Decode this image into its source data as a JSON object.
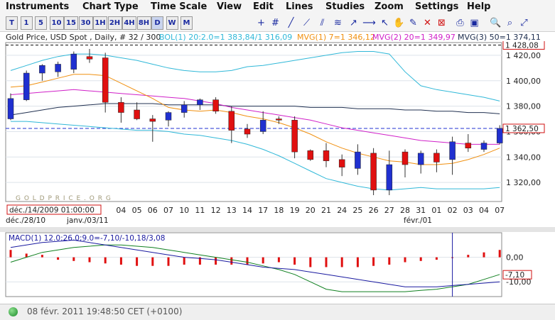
{
  "menu": [
    "Instruments",
    "Chart Type",
    "Time Scale",
    "View",
    "Edit",
    "Lines",
    "Studies",
    "Zoom",
    "Settings",
    "Help"
  ],
  "toolbar": {
    "period_buttons": [
      "T",
      "1",
      "5",
      "10",
      "15",
      "30",
      "1H",
      "2H",
      "4H",
      "8H",
      "D",
      "W",
      "M"
    ],
    "selected": "D"
  },
  "header": {
    "instrument": "Gold Price, USD Spot , Daily, # 32 / 300",
    "bol": "BOL(1) 20:2.0=1 383,84/1 316,09",
    "mvg1": "MVG(1) 7=1 346,12",
    "mvg2": "MVG(2) 20=1 349,97",
    "mvg3": "MVG(3) 50=1 374,11"
  },
  "price_chart": {
    "y_ticks": [
      "1 420,00",
      "1 400,00",
      "1 380,00",
      "1 360,00",
      "1 340,00",
      "1 320,00"
    ],
    "current_price": "1 362,50",
    "top_line_label": "1 428,08",
    "watermark": "G O L D P R I C E . O R G",
    "cursor_date": "déc./14/2009 01:00:00",
    "date_labels": [
      "04",
      "05",
      "06",
      "07",
      "10",
      "11",
      "12",
      "13",
      "14",
      "17",
      "18",
      "19",
      "20",
      "21",
      "24",
      "25",
      "26",
      "27",
      "28",
      "31",
      "01",
      "02",
      "03",
      "04",
      "07"
    ],
    "month_labels": [
      "déc./28/10",
      "janv./03/11",
      "févr./01"
    ]
  },
  "macd_chart": {
    "label": "MACD(1) 12.0:26.0;9.0=-7,10/-10,18/3,08",
    "y_ticks": [
      "0,00",
      "-10,00"
    ],
    "current_value": "-7,10"
  },
  "status": {
    "datetime": "08 févr. 2011 19:48:50  CET (+0100)"
  },
  "colors": {
    "up_candle": "#2030d0",
    "down_candle": "#e01010",
    "bollinger": "#30b8d8",
    "mvg7": "#f09010",
    "mvg20": "#d020c8",
    "mvg50": "#203050",
    "macd": "#1a1aa0",
    "signal": "#108020",
    "histogram": "#e01010"
  },
  "chart_data": {
    "type": "candlestick",
    "title": "Gold Price, USD Spot , Daily",
    "ylim": [
      1305,
      1430
    ],
    "candles": [
      {
        "o": 1370,
        "h": 1390,
        "l": 1369,
        "c": 1386
      },
      {
        "o": 1385,
        "h": 1408,
        "l": 1384,
        "c": 1406
      },
      {
        "o": 1406,
        "h": 1413,
        "l": 1400,
        "c": 1412
      },
      {
        "o": 1407,
        "h": 1415,
        "l": 1403,
        "c": 1413
      },
      {
        "o": 1409,
        "h": 1423,
        "l": 1406,
        "c": 1421
      },
      {
        "o": 1419,
        "h": 1425,
        "l": 1414,
        "c": 1417
      },
      {
        "o": 1418,
        "h": 1422,
        "l": 1375,
        "c": 1383
      },
      {
        "o": 1383,
        "h": 1387,
        "l": 1367,
        "c": 1375
      },
      {
        "o": 1377,
        "h": 1383,
        "l": 1369,
        "c": 1370
      },
      {
        "o": 1370,
        "h": 1373,
        "l": 1352,
        "c": 1368
      },
      {
        "o": 1369,
        "h": 1376,
        "l": 1364,
        "c": 1375
      },
      {
        "o": 1375,
        "h": 1384,
        "l": 1371,
        "c": 1381
      },
      {
        "o": 1381,
        "h": 1386,
        "l": 1377,
        "c": 1385
      },
      {
        "o": 1385,
        "h": 1387,
        "l": 1374,
        "c": 1376
      },
      {
        "o": 1376,
        "h": 1380,
        "l": 1351,
        "c": 1361
      },
      {
        "o": 1362,
        "h": 1366,
        "l": 1355,
        "c": 1358
      },
      {
        "o": 1360,
        "h": 1376,
        "l": 1358,
        "c": 1369
      },
      {
        "o": 1370,
        "h": 1372,
        "l": 1366,
        "c": 1369
      },
      {
        "o": 1369,
        "h": 1372,
        "l": 1339,
        "c": 1344
      },
      {
        "o": 1345,
        "h": 1346,
        "l": 1337,
        "c": 1338
      },
      {
        "o": 1345,
        "h": 1351,
        "l": 1332,
        "c": 1337
      },
      {
        "o": 1338,
        "h": 1342,
        "l": 1325,
        "c": 1332
      },
      {
        "o": 1331,
        "h": 1350,
        "l": 1326,
        "c": 1344
      },
      {
        "o": 1343,
        "h": 1347,
        "l": 1310,
        "c": 1314
      },
      {
        "o": 1314,
        "h": 1345,
        "l": 1310,
        "c": 1334
      },
      {
        "o": 1344,
        "h": 1346,
        "l": 1324,
        "c": 1334
      },
      {
        "o": 1334,
        "h": 1345,
        "l": 1327,
        "c": 1343
      },
      {
        "o": 1343,
        "h": 1346,
        "l": 1328,
        "c": 1336
      },
      {
        "o": 1338,
        "h": 1356,
        "l": 1326,
        "c": 1352
      },
      {
        "o": 1351,
        "h": 1358,
        "l": 1344,
        "c": 1347
      },
      {
        "o": 1346,
        "h": 1353,
        "l": 1344,
        "c": 1351
      },
      {
        "o": 1351,
        "h": 1365,
        "l": 1350,
        "c": 1362.5
      }
    ],
    "mvg7": [
      1395,
      1396,
      1399,
      1402,
      1405,
      1405,
      1404,
      1398,
      1392,
      1386,
      1379,
      1377,
      1376,
      1377,
      1375,
      1372,
      1370,
      1367,
      1363,
      1358,
      1352,
      1347,
      1343,
      1340,
      1337,
      1336,
      1334,
      1334,
      1335,
      1338,
      1342,
      1347
    ],
    "mvg20": [
      1389,
      1390,
      1391,
      1392,
      1393,
      1392,
      1391,
      1390,
      1389,
      1388,
      1387,
      1386,
      1384,
      1382,
      1379,
      1377,
      1375,
      1373,
      1371,
      1369,
      1366,
      1363,
      1361,
      1359,
      1357,
      1355,
      1353,
      1352,
      1351,
      1350,
      1350,
      1350
    ],
    "mvg50": [
      1373,
      1375,
      1377,
      1379,
      1380,
      1381,
      1382,
      1382,
      1382,
      1382,
      1381,
      1381,
      1381,
      1381,
      1380,
      1380,
      1380,
      1380,
      1380,
      1379,
      1379,
      1379,
      1378,
      1378,
      1378,
      1377,
      1377,
      1376,
      1376,
      1375,
      1375,
      1374
    ],
    "bol_upper": [
      1408,
      1412,
      1416,
      1419,
      1421,
      1421,
      1420,
      1418,
      1416,
      1413,
      1410,
      1408,
      1407,
      1407,
      1408,
      1411,
      1412,
      1414,
      1416,
      1418,
      1420,
      1422,
      1423,
      1423,
      1421,
      1407,
      1396,
      1393,
      1391,
      1389,
      1387,
      1384
    ],
    "bol_lower": [
      1368,
      1368,
      1367,
      1366,
      1365,
      1364,
      1363,
      1362,
      1361,
      1361,
      1360,
      1358,
      1357,
      1355,
      1353,
      1350,
      1346,
      1341,
      1335,
      1329,
      1323,
      1320,
      1317,
      1315,
      1314,
      1315,
      1316,
      1315,
      1315,
      1315,
      1315,
      1316
    ],
    "macd": [
      4,
      5,
      6,
      6.5,
      7,
      6,
      5,
      4,
      3,
      2,
      1,
      0,
      -0.5,
      -1,
      -2,
      -3,
      -4,
      -4.5,
      -5,
      -6,
      -7,
      -8,
      -9,
      -10,
      -11,
      -12,
      -12,
      -12,
      -11.5,
      -11,
      -10.5,
      -10
    ],
    "signal": [
      -2,
      0,
      2,
      3,
      4,
      4.5,
      5,
      5,
      4.5,
      4,
      3,
      2,
      1,
      0,
      -1,
      -2,
      -3.5,
      -5,
      -7,
      -10,
      -13,
      -14,
      -14,
      -14,
      -14,
      -14,
      -13.5,
      -13,
      -12,
      -11,
      -9,
      -7
    ],
    "histogram": [
      3,
      1.5,
      1,
      -1,
      -1.5,
      -2,
      -2.5,
      -3,
      -3.5,
      -3.5,
      -3.5,
      -3,
      -3,
      -3,
      -3,
      -3,
      -2.5,
      -2,
      -3,
      -4,
      -4,
      -4,
      -4,
      -3.5,
      -3,
      -2,
      -1.5,
      -1,
      0,
      1,
      2,
      3
    ]
  }
}
